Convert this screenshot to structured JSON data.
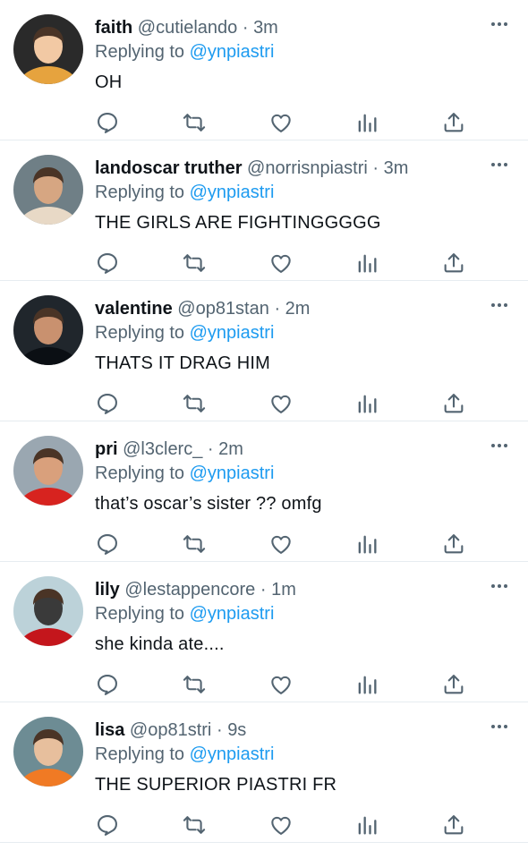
{
  "replies": [
    {
      "name": "faith",
      "handle": "@cutielando",
      "separator": "·",
      "time": "3m",
      "replying_prefix": "Replying to",
      "replying_to": "@ynpiastri",
      "text": "OH",
      "avatar_colors": [
        "#2a2a2a",
        "#e6a33e",
        "#f2c9a4"
      ]
    },
    {
      "name": "landoscar truther",
      "handle": "@norrisnpiastri",
      "separator": "·",
      "time": "3m",
      "replying_prefix": "Replying to",
      "replying_to": "@ynpiastri",
      "text": "THE GIRLS ARE FIGHTINGGGGG",
      "avatar_colors": [
        "#6f7f86",
        "#e8d9c6",
        "#d6a682"
      ]
    },
    {
      "name": "valentine",
      "handle": "@op81stan",
      "separator": "·",
      "time": "2m",
      "replying_prefix": "Replying to",
      "replying_to": "@ynpiastri",
      "text": "THATS IT DRAG HIM",
      "avatar_colors": [
        "#20262c",
        "#0b0f14",
        "#c9916f"
      ]
    },
    {
      "name": "pri",
      "handle": "@l3clerc_",
      "separator": "·",
      "time": "2m",
      "replying_prefix": "Replying to",
      "replying_to": "@ynpiastri",
      "text": "that’s oscar’s sister ?? omfg",
      "avatar_colors": [
        "#9aa7b1",
        "#d7231f",
        "#d9a07c"
      ]
    },
    {
      "name": "lily",
      "handle": "@lestappencore",
      "separator": "·",
      "time": "1m",
      "replying_prefix": "Replying to",
      "replying_to": "@ynpiastri",
      "text": "she kinda ate....",
      "avatar_colors": [
        "#bcd2d9",
        "#c4161c",
        "#3a3a3a"
      ]
    },
    {
      "name": "lisa",
      "handle": "@op81stri",
      "separator": "·",
      "time": "9s",
      "replying_prefix": "Replying to",
      "replying_to": "@ynpiastri",
      "text": "THE SUPERIOR PIASTRI FR",
      "avatar_colors": [
        "#6d8c94",
        "#f07a24",
        "#e7bf9d"
      ]
    }
  ],
  "icons": {
    "more": "more-dots-icon",
    "reply": "reply-icon",
    "retweet": "retweet-icon",
    "like": "heart-icon",
    "stats": "analytics-icon",
    "share": "share-icon"
  },
  "colors": {
    "accent": "#1d9bf0",
    "muted": "#536471",
    "divider": "#e6ecf0",
    "icon": "#536471"
  }
}
